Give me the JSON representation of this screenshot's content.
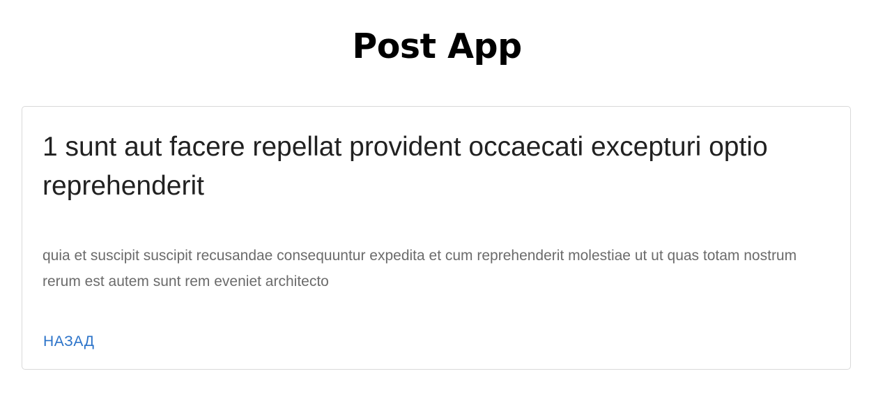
{
  "app": {
    "title": "Post App"
  },
  "post": {
    "id": "1",
    "title": "sunt aut facere repellat provident occaecati excepturi optio reprehenderit",
    "body": "quia et suscipit suscipit recusandae consequuntur expedita et cum reprehenderit molestiae ut ut quas totam nostrum rerum est autem sunt rem eveniet architecto"
  },
  "actions": {
    "back_label": "НАЗАД"
  },
  "colors": {
    "link": "#2b73c9",
    "heading_text": "#212121",
    "body_text": "#6b6b6b",
    "card_border": "#d9d9d9"
  }
}
